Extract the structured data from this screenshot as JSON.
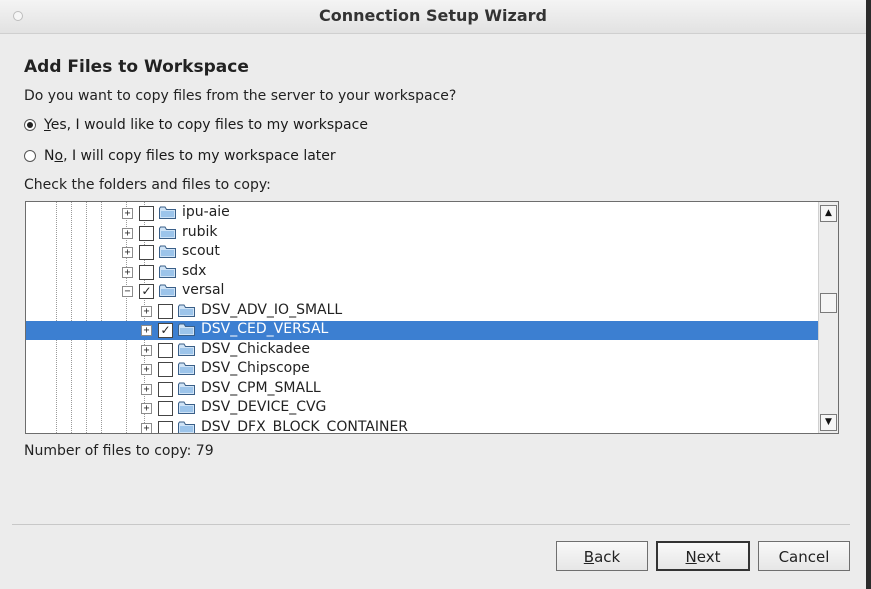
{
  "window": {
    "title": "Connection Setup Wizard"
  },
  "page": {
    "heading": "Add Files to Workspace",
    "question": "Do you want to copy files from the server to your workspace?",
    "options": [
      {
        "mn": "Y",
        "rest": "es, I would like to copy files to my workspace",
        "selected": true
      },
      {
        "pre": "N",
        "mn": "o",
        "rest": ", I will copy files to my workspace later",
        "selected": false
      }
    ],
    "tree_label": "Check the folders and files to copy:",
    "tree": [
      {
        "label": "ipu-aie",
        "checked": false
      },
      {
        "label": "rubik",
        "checked": false
      },
      {
        "label": "scout",
        "checked": false
      },
      {
        "label": "sdx",
        "checked": false
      },
      {
        "label": "versal",
        "checked": true,
        "expanded": true
      },
      {
        "label": "DSV_ADV_IO_SMALL",
        "checked": false
      },
      {
        "label": "DSV_CED_VERSAL",
        "checked": true,
        "selected": true
      },
      {
        "label": "DSV_Chickadee",
        "checked": false
      },
      {
        "label": "DSV_Chipscope",
        "checked": false
      },
      {
        "label": "DSV_CPM_SMALL",
        "checked": false
      },
      {
        "label": "DSV_DEVICE_CVG",
        "checked": false
      },
      {
        "label": "DSV_DFX_BLOCK_CONTAINER",
        "checked": false
      }
    ],
    "file_count_label": "Number of files to copy:",
    "file_count": "79"
  },
  "buttons": {
    "back": {
      "mn": "B",
      "rest": "ack"
    },
    "next": {
      "mn": "N",
      "rest": "ext"
    },
    "cancel": "Cancel"
  },
  "icons": {
    "expand": "plus-box-icon",
    "collapse": "minus-box-icon",
    "folder": "folder-icon",
    "check": "checkmark-icon",
    "scroll_up": "arrow-up-icon",
    "scroll_down": "arrow-down-icon"
  },
  "colors": {
    "selection": "#3c7fd1",
    "window_bg": "#ececec"
  }
}
